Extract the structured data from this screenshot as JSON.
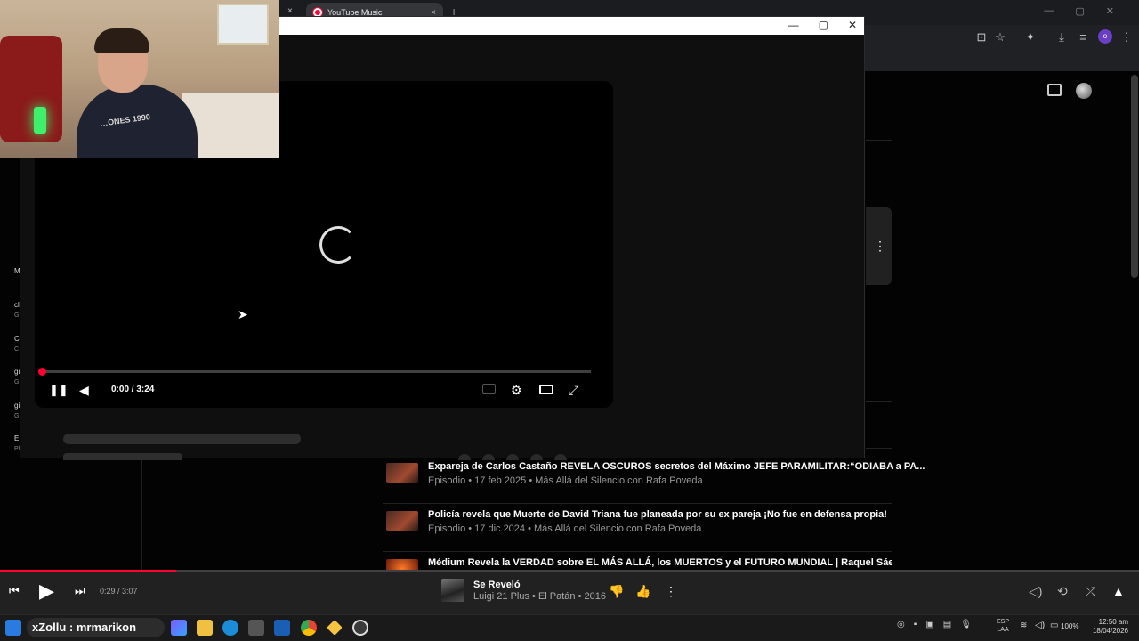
{
  "browser": {
    "active_tab_title": "YouTube Music",
    "tab_close_glyph": "×",
    "new_tab_glyph": "+",
    "window_buttons": [
      "—",
      "▢",
      "✕"
    ],
    "toolbar_icons": [
      "install-icon",
      "star-icon",
      "extensions-icon",
      "download-icon",
      "media-icon",
      "profile-icon",
      "menu-icon"
    ],
    "profile_initial": "o"
  },
  "popup": {
    "window_buttons": [
      "—",
      "▢",
      "✕"
    ],
    "player": {
      "current_time": "0:00",
      "duration": "3:24",
      "time_display": "0:00 / 3:24",
      "progress": 0.0,
      "state": "loading"
    }
  },
  "background_list": {
    "items": [
      {
        "title": "Expareja de Carlos Castaño REVELA OSCUROS secretos del Máximo JEFE PARAMILITAR:“ODIABA a PA...",
        "subtitle": "Episodio • 17 feb 2025 • Más Allá del Silencio con Rafa Poveda"
      },
      {
        "title": "Policía revela que Muerte de David Triana fue planeada por su ex pareja ¡No fue en defensa propia!",
        "subtitle": "Episodio • 17 dic 2024 • Más Allá del Silencio con Rafa Poveda"
      },
      {
        "title": "Médium Revela la VERDAD sobre EL MÁS ALLÁ, los MUERTOS y el FUTURO MUNDIAL | Raquel Sáez",
        "subtitle": ""
      }
    ],
    "sidebar_fragments": [
      "M",
      "cl",
      "C",
      "gi",
      "gi",
      "E"
    ],
    "sidebar_sub_fragments": [
      "G",
      "C",
      "G",
      "G",
      "Pl"
    ]
  },
  "music_player": {
    "time_display": "0:29 / 3:07",
    "progress": 0.155,
    "song_title": "Se Reveló",
    "song_subtitle": "Luigi 21 Plus • El Patán • 2016",
    "colors": {
      "accent": "#ff0033",
      "bar": "#212121"
    }
  },
  "webcam": {
    "shirt_text": "…ONES 1990"
  },
  "taskbar": {
    "overlay_text": "xZollu : mrmarikon",
    "language_top": "ESP",
    "language_bottom": "LAA",
    "battery": "100%",
    "time": "12:50 am",
    "date": "18/04/2026"
  }
}
